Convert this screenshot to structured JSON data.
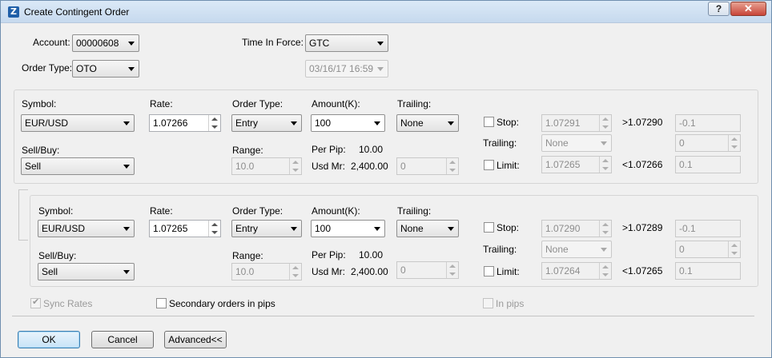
{
  "window": {
    "title": "Create Contingent Order",
    "help": "?",
    "close": "✕",
    "icon": "Z"
  },
  "header": {
    "account_label": "Account:",
    "account_value": "00000608",
    "order_type_label": "Order Type:",
    "order_type_value": "OTO",
    "tif_label": "Time In Force:",
    "tif_value": "GTC",
    "expiry_value": "03/16/17 16:59"
  },
  "primary": {
    "symbol_label": "Symbol:",
    "symbol_value": "EUR/USD",
    "rate_label": "Rate:",
    "rate_value": "1.07266",
    "order_type_label": "Order Type:",
    "order_type_value": "Entry",
    "amount_label": "Amount(K):",
    "amount_value": "100",
    "trailing_label": "Trailing:",
    "trailing_value": "None",
    "sellbuy_label": "Sell/Buy:",
    "sellbuy_value": "Sell",
    "range_label": "Range:",
    "range_value": "10.0",
    "perpip_label": "Per Pip:",
    "perpip_value": "10.00",
    "usdmr_label": "Usd Mr:",
    "usdmr_value": "2,400.00",
    "extra_value": "0",
    "stop_label": "Stop:",
    "stop_rate": "1.07291",
    "stop_compare": ">1.07290",
    "stop_pips": "-0.1",
    "stop_trailing_label": "Trailing:",
    "stop_trailing_value": "None",
    "stop_trailing_num": "0",
    "limit_label": "Limit:",
    "limit_rate": "1.07265",
    "limit_compare": "<1.07266",
    "limit_pips": "0.1"
  },
  "secondary": {
    "symbol_label": "Symbol:",
    "symbol_value": "EUR/USD",
    "rate_label": "Rate:",
    "rate_value": "1.07265",
    "order_type_label": "Order Type:",
    "order_type_value": "Entry",
    "amount_label": "Amount(K):",
    "amount_value": "100",
    "trailing_label": "Trailing:",
    "trailing_value": "None",
    "sellbuy_label": "Sell/Buy:",
    "sellbuy_value": "Sell",
    "range_label": "Range:",
    "range_value": "10.0",
    "perpip_label": "Per Pip:",
    "perpip_value": "10.00",
    "usdmr_label": "Usd Mr:",
    "usdmr_value": "2,400.00",
    "extra_value": "0",
    "stop_label": "Stop:",
    "stop_rate": "1.07290",
    "stop_compare": ">1.07289",
    "stop_pips": "-0.1",
    "stop_trailing_label": "Trailing:",
    "stop_trailing_value": "None",
    "stop_trailing_num": "0",
    "limit_label": "Limit:",
    "limit_rate": "1.07264",
    "limit_compare": "<1.07265",
    "limit_pips": "0.1"
  },
  "options": {
    "sync_rates": "Sync Rates",
    "secondary_pips": "Secondary orders in pips",
    "in_pips": "In pips"
  },
  "footer": {
    "ok": "OK",
    "cancel": "Cancel",
    "advanced": "Advanced<<"
  }
}
